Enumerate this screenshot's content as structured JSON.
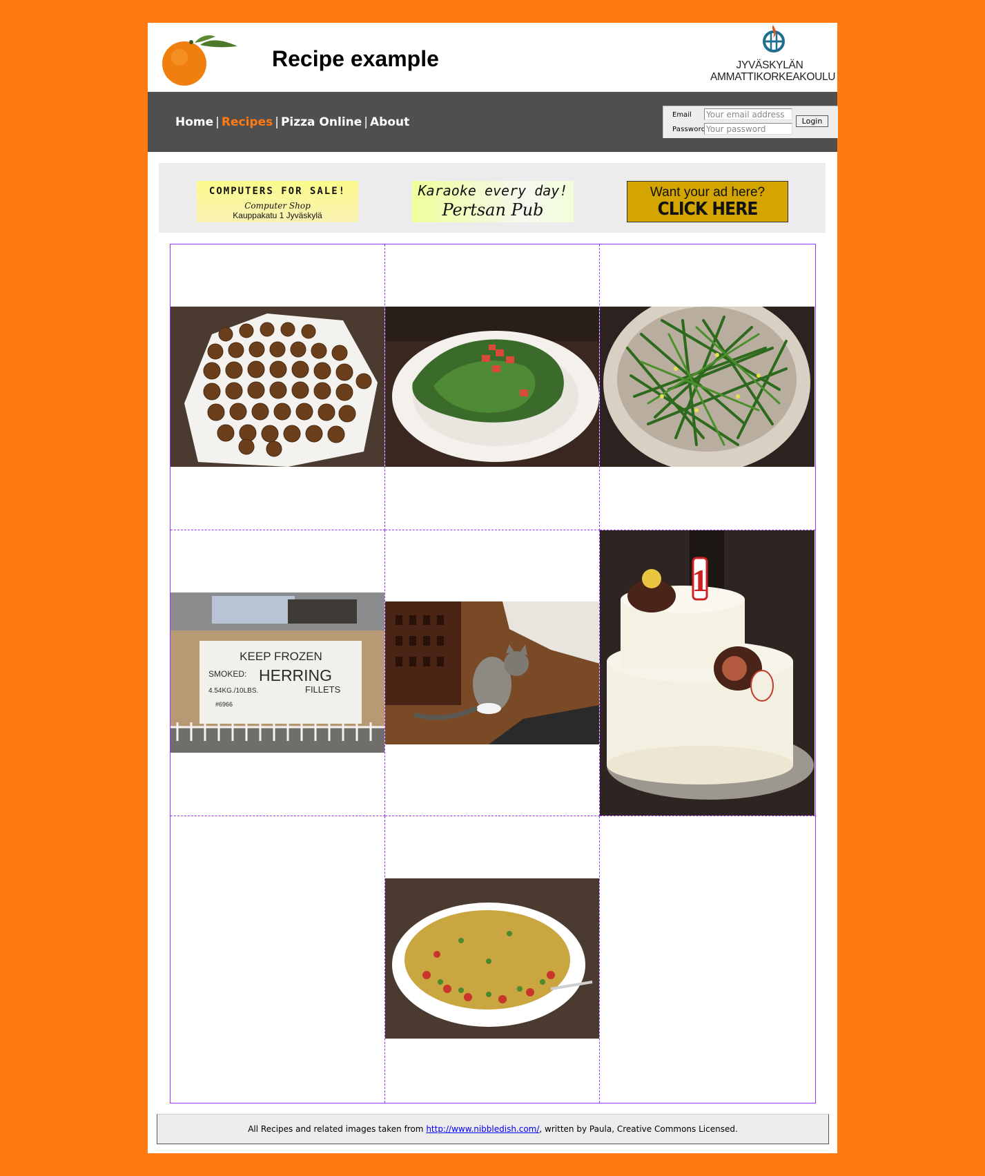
{
  "header": {
    "title": "Recipe example",
    "logo_alt": "orange-logo",
    "institution_line1": "JYVÄSKYLÄN",
    "institution_line2": "AMMATTIKORKEAKOULU"
  },
  "nav": {
    "items": [
      {
        "label": "Home",
        "active": false
      },
      {
        "label": "Recipes",
        "active": true
      },
      {
        "label": "Pizza Online",
        "active": false
      },
      {
        "label": "About",
        "active": false
      }
    ],
    "separator": "|"
  },
  "login": {
    "email_label": "Email",
    "password_label": "Password",
    "email_placeholder": "Your email address",
    "password_placeholder": "Your password",
    "button_label": "Login"
  },
  "ads": {
    "computers": {
      "line1": "COMPUTERS FOR SALE!",
      "line2": "Computer Shop",
      "line3": "Kauppakatu 1 Jyväskylä"
    },
    "karaoke": {
      "line1": "Karaoke every day!",
      "line2": "Pertsan Pub"
    },
    "yours": {
      "line1": "Want your ad here?",
      "line2": "CLICK HERE"
    }
  },
  "recipes": [
    {
      "image": "fish-cakes-photo"
    },
    {
      "image": "salad-plate-photo"
    },
    {
      "image": "green-beans-bowl-photo"
    },
    {
      "image": "keep-frozen-herring-box-photo",
      "visible_text": [
        "KEEP FROZEN",
        "SMOKED:",
        "HERRING",
        "FILLETS",
        "4.54KG./10LBS.",
        "#6966"
      ]
    },
    {
      "image": "cat-photo"
    },
    {
      "image": "birthday-cake-photo"
    },
    {
      "image": null
    },
    {
      "image": "casserole-photo"
    },
    {
      "image": null
    }
  ],
  "footer": {
    "text_before": "All Recipes and related images taken from ",
    "link_text": "http://www.nibbledish.com/",
    "text_after": ", written by Paula, Creative Commons Licensed."
  },
  "colors": {
    "background": "#FF7A13",
    "navbar": "#4F4F4F",
    "active_nav": "#FF7A13",
    "grid_border": "#9933FF",
    "ad_bar": "#ECECEC"
  }
}
